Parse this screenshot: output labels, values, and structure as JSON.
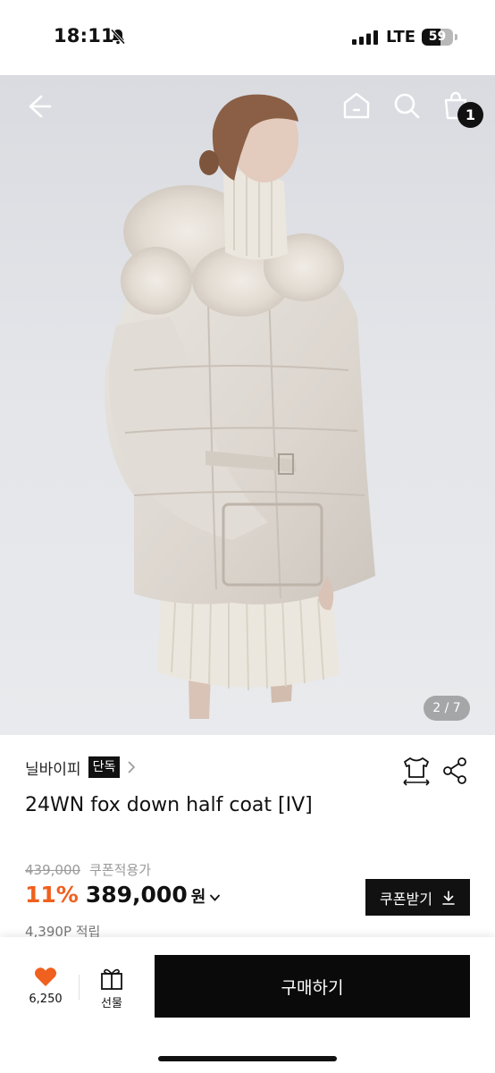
{
  "status_bar": {
    "time": "18:11",
    "network": "LTE",
    "battery_level": 59,
    "battery_label": "59",
    "icons": [
      "bell-slash-icon",
      "signal-bars-icon",
      "battery-icon"
    ]
  },
  "header": {
    "icons": [
      "back-arrow-icon",
      "home-icon",
      "search-icon",
      "shopping-bag-icon"
    ],
    "cart_count": "1"
  },
  "gallery": {
    "counter": "2 / 7",
    "current": 2,
    "total": 7
  },
  "product": {
    "brand": "닐바이피",
    "exclusive_badge": "단독",
    "title": "24WN fox down half coat [IV]",
    "original_price": "439,000",
    "coupon_applied_label": "쿠폰적용가",
    "discount_rate": "11%",
    "final_price": "389,000",
    "currency": "원",
    "coupon_button_label": "쿠폰받기",
    "points": "4,390P 적립"
  },
  "bottom_bar": {
    "like_count": "6,250",
    "gift_label": "선물",
    "buy_label": "구매하기"
  },
  "colors": {
    "accent_discount": "#f0601e",
    "like_heart": "#f0601e",
    "primary_button": "#0a0a0a"
  }
}
